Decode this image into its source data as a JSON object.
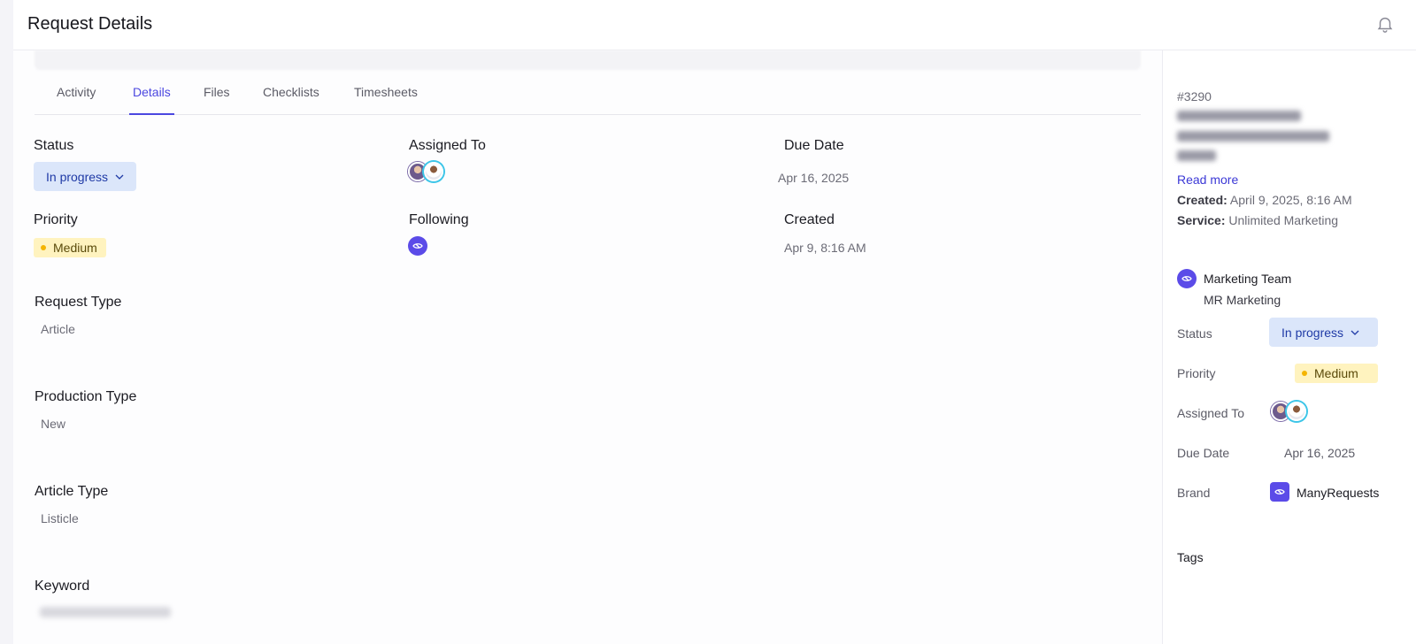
{
  "header": {
    "title": "Request Details",
    "bell_icon": "bell-icon"
  },
  "tabs": [
    {
      "label": "Activity",
      "active": false
    },
    {
      "label": "Details",
      "active": true
    },
    {
      "label": "Files",
      "active": false
    },
    {
      "label": "Checklists",
      "active": false
    },
    {
      "label": "Timesheets",
      "active": false
    }
  ],
  "details": {
    "status_label": "Status",
    "status_value": "In progress",
    "assigned_label": "Assigned To",
    "due_label": "Due Date",
    "due_value": "Apr 16, 2025",
    "priority_label": "Priority",
    "priority_value": "Medium",
    "following_label": "Following",
    "created_label": "Created",
    "created_value": "Apr 9, 8:16 AM",
    "request_type_label": "Request Type",
    "request_type_value": "Article",
    "production_type_label": "Production Type",
    "production_type_value": "New",
    "article_type_label": "Article Type",
    "article_type_value": "Listicle",
    "keyword_label": "Keyword"
  },
  "sidebar": {
    "id": "#3290",
    "read_more": "Read more",
    "created_label": "Created:",
    "created_value": "April 9, 2025, 8:16 AM",
    "service_label": "Service:",
    "service_value": "Unlimited Marketing",
    "team_name": "Marketing Team",
    "team_sub": "MR Marketing",
    "status_label": "Status",
    "status_value": "In progress",
    "priority_label": "Priority",
    "priority_value": "Medium",
    "assigned_label": "Assigned To",
    "due_label": "Due Date",
    "due_value": "Apr 16, 2025",
    "brand_label": "Brand",
    "brand_value": "ManyRequests",
    "tags_label": "Tags"
  },
  "colors": {
    "accent": "#4b47e0",
    "status_bg": "#dbe6fa",
    "priority_bg": "#fff3bf",
    "priority_dot": "#f4b400",
    "team_icon": "#5b4be8"
  }
}
